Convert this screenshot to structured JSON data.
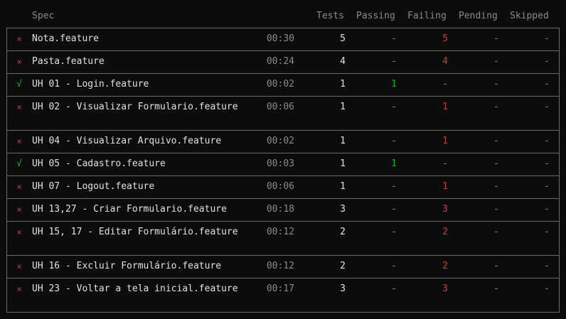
{
  "header": {
    "spec": "Spec",
    "tests": "Tests",
    "passing": "Passing",
    "failing": "Failing",
    "pending": "Pending",
    "skipped": "Skipped"
  },
  "colors": {
    "fail": "#d23a3a",
    "pass": "#23b135",
    "muted": "#8a8a8a",
    "border": "#6a6a6a",
    "background": "#0c0c0c"
  },
  "rows": [
    {
      "status": "fail",
      "icon": "×",
      "spec": "Nota.feature",
      "duration": "00:30",
      "tests": "5",
      "passing": "-",
      "failing": "5",
      "pending": "-",
      "skipped": "-"
    },
    {
      "status": "fail",
      "icon": "×",
      "spec": "Pasta.feature",
      "duration": "00:24",
      "tests": "4",
      "passing": "-",
      "failing": "4",
      "pending": "-",
      "skipped": "-"
    },
    {
      "status": "pass",
      "icon": "√",
      "spec": "UH 01 - Login.feature",
      "duration": "00:02",
      "tests": "1",
      "passing": "1",
      "failing": "-",
      "pending": "-",
      "skipped": "-"
    },
    {
      "status": "fail",
      "icon": "×",
      "spec": "UH 02 - Visualizar Formulario.feature",
      "duration": "00:06",
      "tests": "1",
      "passing": "-",
      "failing": "1",
      "pending": "-",
      "skipped": "-"
    },
    {
      "status": "fail",
      "icon": "×",
      "spec": "UH 04 - Visualizar Arquivo.feature",
      "duration": "00:02",
      "tests": "1",
      "passing": "-",
      "failing": "1",
      "pending": "-",
      "skipped": "-"
    },
    {
      "status": "pass",
      "icon": "√",
      "spec": "UH 05 - Cadastro.feature",
      "duration": "00:03",
      "tests": "1",
      "passing": "1",
      "failing": "-",
      "pending": "-",
      "skipped": "-"
    },
    {
      "status": "fail",
      "icon": "×",
      "spec": "UH 07 - Logout.feature",
      "duration": "00:06",
      "tests": "1",
      "passing": "-",
      "failing": "1",
      "pending": "-",
      "skipped": "-"
    },
    {
      "status": "fail",
      "icon": "×",
      "spec": "UH 13,27 - Criar Formulario.feature",
      "duration": "00:18",
      "tests": "3",
      "passing": "-",
      "failing": "3",
      "pending": "-",
      "skipped": "-"
    },
    {
      "status": "fail",
      "icon": "×",
      "spec": "UH 15, 17 - Editar Formulário.feature",
      "duration": "00:12",
      "tests": "2",
      "passing": "-",
      "failing": "2",
      "pending": "-",
      "skipped": "-"
    },
    {
      "status": "fail",
      "icon": "×",
      "spec": "UH 16 - Excluir Formulário.feature",
      "duration": "00:12",
      "tests": "2",
      "passing": "-",
      "failing": "2",
      "pending": "-",
      "skipped": "-"
    },
    {
      "status": "fail",
      "icon": "×",
      "spec": "UH 23 - Voltar a tela inicial.feature",
      "duration": "00:17",
      "tests": "3",
      "passing": "-",
      "failing": "3",
      "pending": "-",
      "skipped": "-"
    }
  ]
}
